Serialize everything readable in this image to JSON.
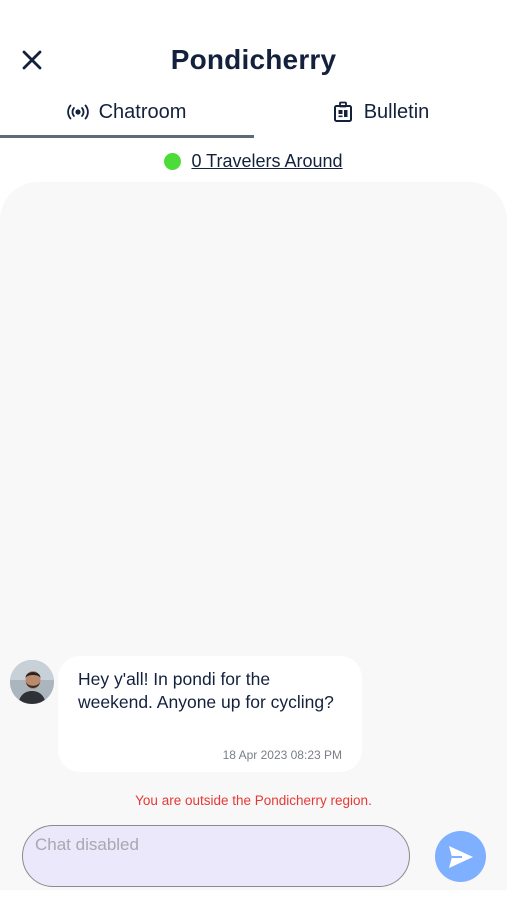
{
  "header": {
    "title": "Pondicherry",
    "close_icon": "close-icon"
  },
  "tabs": [
    {
      "label": "Chatroom",
      "icon": "broadcast-icon",
      "active": true
    },
    {
      "label": "Bulletin",
      "icon": "bulletin-board-icon",
      "active": false
    }
  ],
  "travelers": {
    "label": "0 Travelers Around",
    "status_color": "#4cdc3a"
  },
  "messages": [
    {
      "text": "Hey y'all! In pondi for the weekend. Anyone up for cycling?",
      "timestamp": "18 Apr 2023 08:23 PM"
    }
  ],
  "notice": {
    "text": "You are outside the Pondicherry region.",
    "color": "#e53935"
  },
  "composer": {
    "placeholder": "Chat disabled",
    "value": "",
    "send_icon": "send-icon",
    "send_color": "#7eb0ff"
  }
}
